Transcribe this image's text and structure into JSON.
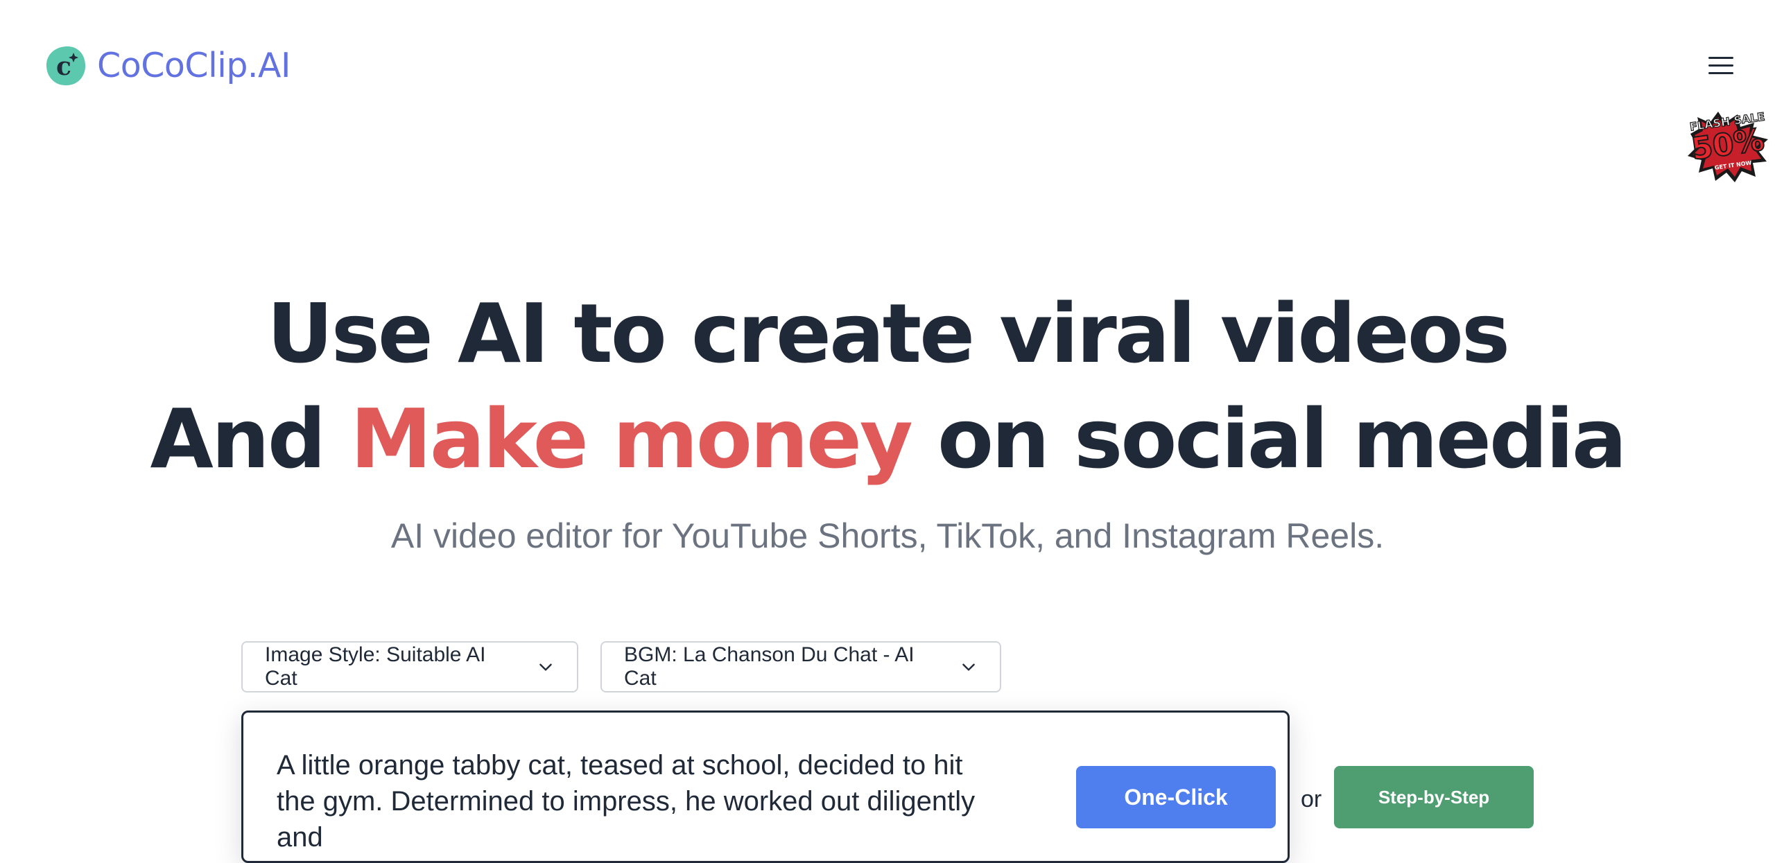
{
  "header": {
    "logo_text": "CoCoClip.AI",
    "logo_mark_letter": "c",
    "menu_icon": "hamburger-menu-icon",
    "sale_badge": {
      "line1": "FLASH SALE",
      "line2": "50%",
      "line3": "GET IT NOW"
    }
  },
  "hero": {
    "line1": "Use AI to create viral videos",
    "line2_before": "And",
    "line2_accent": "Make money",
    "line2_after": "on social media",
    "subtitle": "AI video editor for YouTube Shorts, TikTok, and Instagram Reels."
  },
  "controls": {
    "image_style": "Image Style: Suitable AI Cat",
    "bgm": "BGM: La Chanson Du Chat - AI Cat",
    "dropdown_icon": "chevron-down-icon"
  },
  "prompt": {
    "value": "A little orange tabby cat, teased at school, decided to hit the gym. Determined to impress, he worked out diligently and"
  },
  "actions": {
    "one_click": "One-Click",
    "or": "or",
    "step_by_step": "Step-by-Step"
  },
  "colors": {
    "brand": "#6272e0",
    "accent": "#e05a5a",
    "primary_button": "#4f7fef",
    "secondary_button": "#4f9e72",
    "logo_bg": "#5cc8ad"
  }
}
